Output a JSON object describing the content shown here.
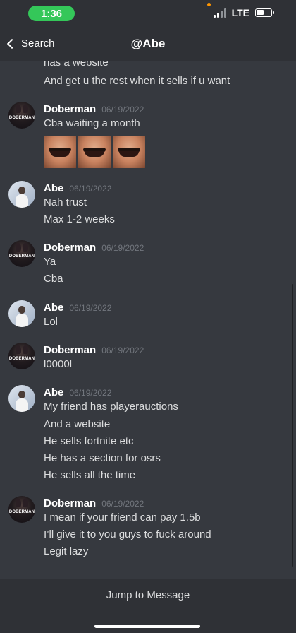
{
  "status_bar": {
    "time": "1:36",
    "network": "LTE",
    "battery_level": 0.55
  },
  "header": {
    "back_label": "Search",
    "title": "@Abe"
  },
  "messages": [
    {
      "lines": [
        "has a website",
        "And get u the rest when it sells if u want"
      ]
    },
    {
      "author": "Doberman",
      "timestamp": "06/19/2022",
      "lines": [
        "Cba waiting a month"
      ],
      "images": 3
    },
    {
      "author": "Abe",
      "timestamp": "06/19/2022",
      "lines": [
        "Nah trust",
        "Max 1-2 weeks"
      ]
    },
    {
      "author": "Doberman",
      "timestamp": "06/19/2022",
      "lines": [
        "Ya",
        "Cba"
      ]
    },
    {
      "author": "Abe",
      "timestamp": "06/19/2022",
      "lines": [
        "Lol"
      ]
    },
    {
      "author": "Doberman",
      "timestamp": "06/19/2022",
      "lines": [
        "l0000l"
      ]
    },
    {
      "author": "Abe",
      "timestamp": "06/19/2022",
      "lines": [
        "My friend has playerauctions",
        "And a website",
        "He sells fortnite etc",
        "He has a section for osrs",
        "He sells all the time"
      ]
    },
    {
      "author": "Doberman",
      "timestamp": "06/19/2022",
      "lines": [
        "I mean if your friend can pay 1.5b",
        "I’ll give it to you guys to fuck around",
        "Legit lazy"
      ]
    }
  ],
  "avatar_text": {
    "doberman": "DOBERMAN"
  },
  "bottom": {
    "jump_label": "Jump to Message"
  }
}
